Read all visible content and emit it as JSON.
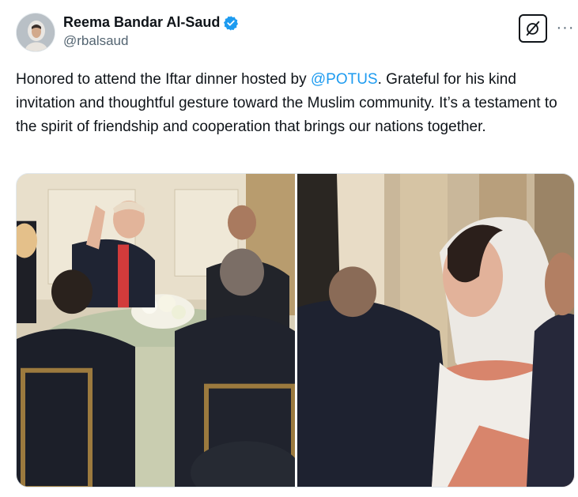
{
  "author": {
    "display_name": "Reema Bandar Al-Saud",
    "handle": "@rbalsaud",
    "avatar_icon": "profile-avatar",
    "verified_icon": "verified-badge-icon",
    "verified_color": "#1d9bf0"
  },
  "actions": {
    "grok_icon": "grok-icon",
    "more_icon": "more-options-icon",
    "more_glyph": "···"
  },
  "tweet": {
    "text_before": "Honored to attend the Iftar dinner hosted by ",
    "mention": "@POTUS",
    "text_after": ". Grateful for his kind invitation and thoughtful gesture toward the Muslim community. It’s a testament to the spirit of friendship and cooperation that brings our nations together.",
    "mention_color": "#1d9bf0"
  },
  "media": {
    "photo_count": 2,
    "photos": [
      "dinner-table-photo",
      "guest-in-white-headscarf-photo"
    ]
  }
}
